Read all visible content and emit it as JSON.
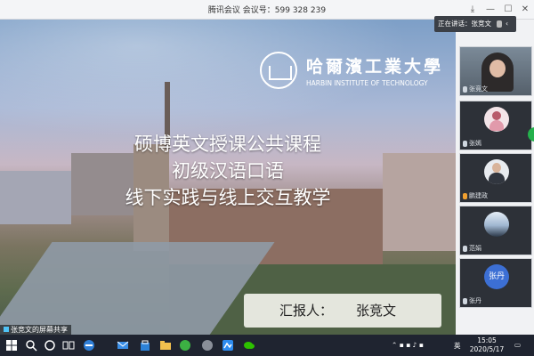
{
  "window": {
    "title_prefix": "腾讯会议 会议号：",
    "meeting_id": "599 328 239"
  },
  "slide": {
    "university_cn": "哈爾濱工業大學",
    "university_en": "HARBIN INSTITUTE OF TECHNOLOGY",
    "line1": "硕博英文授课公共课程",
    "line2": "初级汉语口语",
    "line3": "线下实践与线上交互教学",
    "reporter_label": "汇报人：",
    "reporter_name": "张竞文"
  },
  "share_label": "张竞文的屏幕共享",
  "speaking": {
    "label": "正在讲话：张竞文"
  },
  "participants": [
    {
      "name": "张竞文",
      "kind": "video"
    },
    {
      "name": "张嫣",
      "kind": "avatar"
    },
    {
      "name": "鹏建政",
      "kind": "avatar"
    },
    {
      "name": "范娟",
      "kind": "avatar"
    },
    {
      "name": "张丹",
      "kind": "avatar-text",
      "avatar_text": "张丹"
    }
  ],
  "taskbar": {
    "time": "15:05",
    "date": "2020/5/17",
    "lang": "英"
  },
  "colors": {
    "accent_green": "#24b14c",
    "taskbar": "#1f2430",
    "avatar_blue": "#3c6fd4"
  }
}
